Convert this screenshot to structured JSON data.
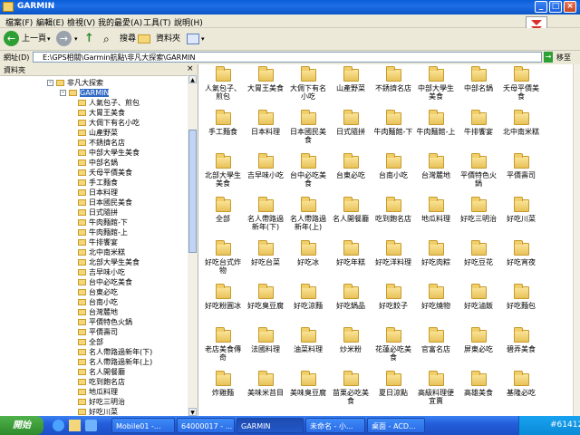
{
  "window": {
    "title": "GARMIN"
  },
  "menu": [
    "檔案(F)",
    "編輯(E)",
    "檢視(V)",
    "我的最愛(A)",
    "工具(T)",
    "說明(H)"
  ],
  "toolbar": {
    "back": "上一頁",
    "search": "搜尋",
    "folders": "資料夾"
  },
  "address": {
    "label": "網址(D)",
    "path": "E:\\GPS相關\\Garmin航點\\非凡大探索\\GARMIN",
    "go": "移至"
  },
  "left_pane": {
    "header": "資料夾",
    "close": "×"
  },
  "tree": {
    "parent": "非凡大探索",
    "current": "GARMIN",
    "children": [
      "人氣包子、煎包",
      "大胃王美食",
      "大倜下有名小吃",
      "山產野菜",
      "不銹擠名店",
      "中部大學生美食",
      "中部名鍋",
      "夭母平價美食",
      "手工麵食",
      "日本料理",
      "日本國民美食",
      "日式隨拼",
      "牛肉麵館-下",
      "牛肉麵館-上",
      "牛排饗宴",
      "北中南米糕",
      "北部大學生美食",
      "吉早味小吃",
      "台中必吃美食",
      "台東必吃",
      "台南小吃",
      "台灣麓地",
      "平價特色火鍋",
      "平價壽司",
      "全部",
      "名人帶路過新年(下)",
      "名人帶路過新年(上)",
      "名人開餐廳",
      "吃到飽名店",
      "地瓜料理",
      "好吃三明治",
      "好吃川菜",
      "好吃台式炸物"
    ]
  },
  "folders": [
    "人氣包子、煎包",
    "大胃王美食",
    "大倜下有名小吃",
    "山產野菜",
    "不銹擠名店",
    "中部大學生美食",
    "中部名鍋",
    "夭母平價美食",
    "手工麵食",
    "日本料理",
    "日本國民美食",
    "日式隨拼",
    "牛肉麵館-下",
    "牛肉麵館-上",
    "牛排饗宴",
    "北中南米糕",
    "北部大學生美食",
    "吉早味小吃",
    "台中必吃美食",
    "台東必吃",
    "台南小吃",
    "台灣麓地",
    "平價特色火鍋",
    "平價壽司",
    "全部",
    "名人帶路過新年(下)",
    "名人帶路過新年(上)",
    "名人開餐廳",
    "吃到飽名店",
    "地瓜料理",
    "好吃三明治",
    "好吃川菜",
    "好吃台式炸物",
    "好吃台菜",
    "好吃冰",
    "好吃年糕",
    "好吃洋料理",
    "好吃肉粽",
    "好吃豆花",
    "好吃宵夜",
    "好吃粉圓冰",
    "好吃臭豆腐",
    "好吃涼麵",
    "好吃鍋品",
    "好吃餃子",
    "好吃燒物",
    "好吃滷飯",
    "好吃麵包",
    "老店美食傳奇",
    "法國料理",
    "油菜料理",
    "炒米粉",
    "花蓮必吃美食",
    "官富名店",
    "屏東必吃",
    "碧弄美食",
    "炸雞麵",
    "美味米苔目",
    "美味臭豆腐",
    "苗栗必吃美食",
    "夏日涼點",
    "高級料理便宜賣",
    "高雄美食",
    "基隆必吃"
  ],
  "taskbar": {
    "start": "開始",
    "tasks": [
      "Mobile01 -...",
      "64000017 - ...",
      "GARMIN",
      "未命名 - 小...",
      "桌面 - ACD..."
    ],
    "tray_text": "#61412"
  }
}
